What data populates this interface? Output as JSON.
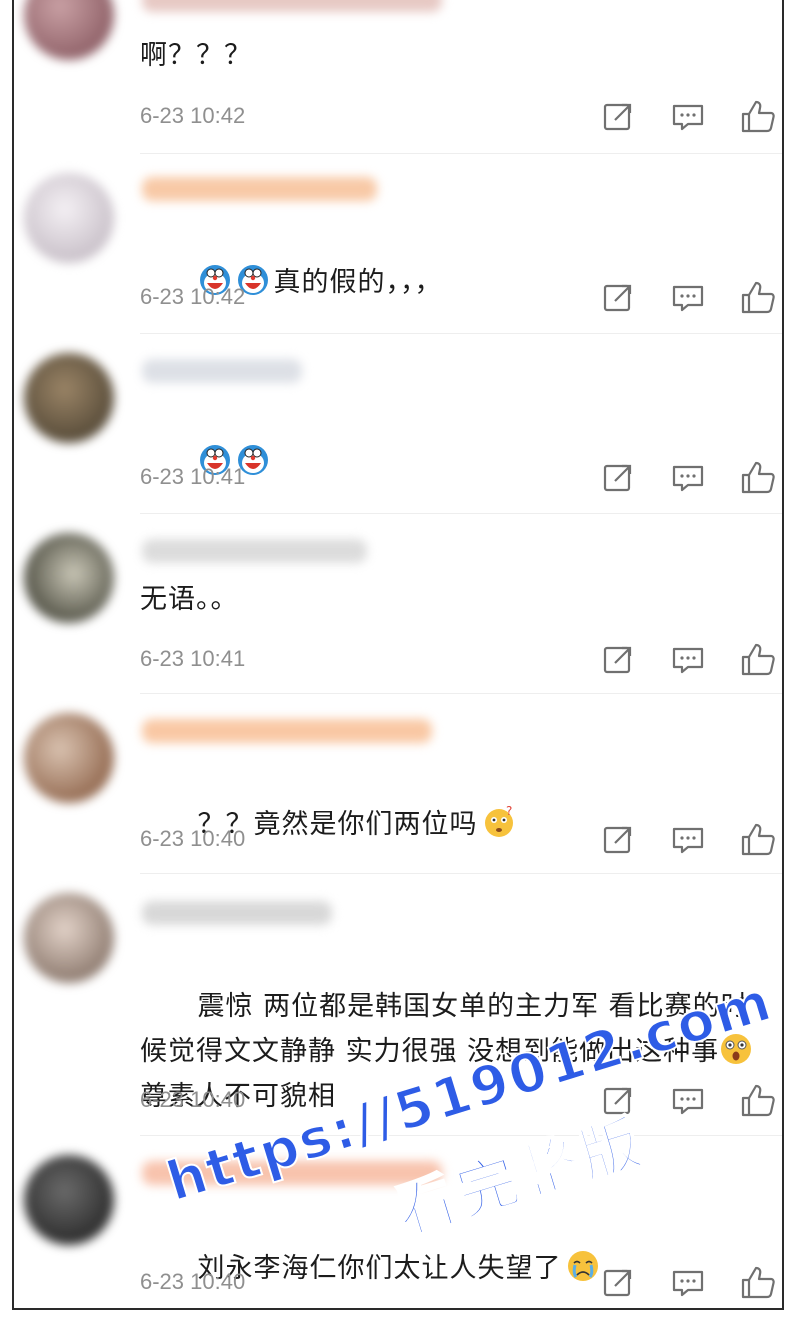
{
  "colors": {
    "timestamp": "#8f8f8f",
    "text": "#1c1c1c",
    "icon": "#707070",
    "watermark": "#2e5ce6"
  },
  "comments": [
    {
      "text": "啊？？？",
      "time": "6-23 10:42",
      "avatar_color": "#9a6a70",
      "name_color": "#c9a19d"
    },
    {
      "emoji": [
        "doraemon-laugh-emoji",
        "doraemon-laugh-emoji"
      ],
      "text": "真的假的，，，",
      "time": "6-23 10:42",
      "avatar_color": "#d8d2da",
      "name_color": "#f5b089"
    },
    {
      "emoji": [
        "doraemon-laugh-emoji",
        "doraemon-laugh-emoji"
      ],
      "text": "",
      "time": "6-23 10:41",
      "avatar_color": "#6b5a41",
      "name_color": "#d4d8e0"
    },
    {
      "text": "无语。。",
      "time": "6-23 10:41",
      "avatar_color": "#3b3d2c",
      "name_color": "#d6d6d6"
    },
    {
      "text": "？？竟然是你们两位吗",
      "emoji_after": "thinking-face-emoji",
      "time": "6-23 10:40",
      "avatar_color": "#9c6e58",
      "name_color": "#f7c29c"
    },
    {
      "text_before": "震惊 两位都是韩国女单的主力军 看比赛的时候觉得文文静静 实力很强 没想到能做出这种事",
      "emoji_mid": "astonished-face-emoji",
      "text_after": "尊素人不可貌相",
      "time": "6-23 10:40",
      "avatar_color": "#8a7568",
      "name_color": "#d2d2d2"
    },
    {
      "text": "刘永李海仁你们太让人失望了",
      "emoji_after": "crying-face-emoji",
      "time": "6-23 10:40",
      "avatar_color": "#3a3a3a",
      "name_color": "#f5b6a0"
    }
  ],
  "actions": {
    "repost_icon": "share-square-icon",
    "comment_icon": "comment-bubble-icon",
    "like_icon": "thumbs-up-icon"
  },
  "watermark": {
    "url": "https://519012.com",
    "text": "看完整版"
  }
}
